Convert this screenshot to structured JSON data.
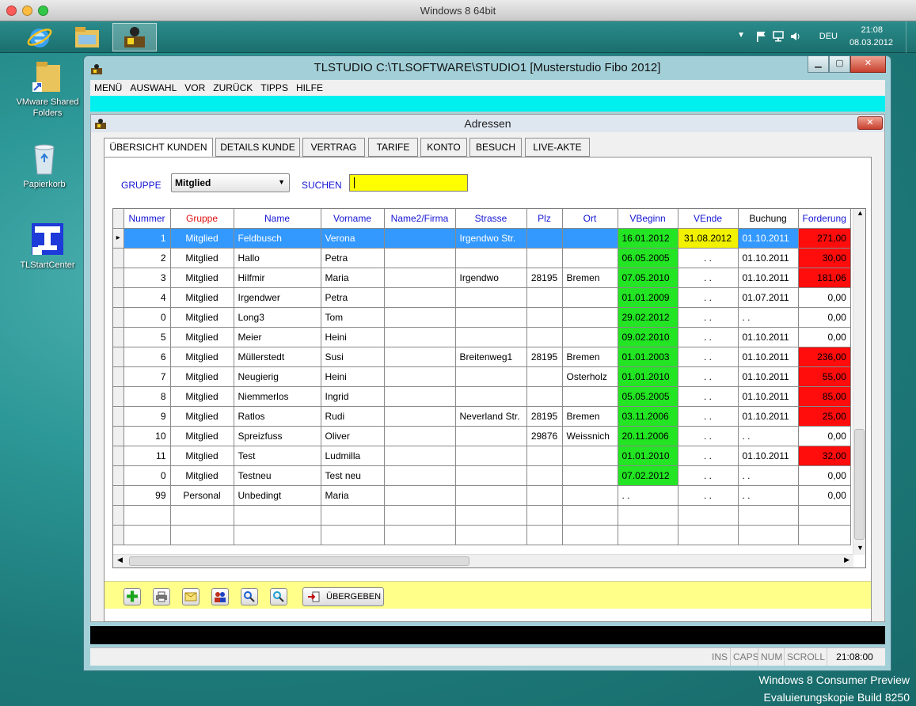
{
  "host": {
    "title": "Windows 8 64bit"
  },
  "taskbar": {
    "items": [
      "internet-explorer-icon",
      "file-explorer-icon",
      "tlstudio-app-icon"
    ]
  },
  "tray": {
    "language": "DEU",
    "time": "21:08",
    "date": "08.03.2012"
  },
  "desktop": {
    "icons": [
      {
        "label": "VMware Shared Folders"
      },
      {
        "label": "Papierkorb"
      },
      {
        "label": "TLStartCenter"
      }
    ]
  },
  "window": {
    "title": "TLSTUDIO C:\\TLSOFTWARE\\STUDIO1 [Musterstudio Fibo 2012]"
  },
  "menu": [
    "MENÜ",
    "AUSWAHL",
    "VOR",
    "ZURÜCK",
    "TIPPS",
    "HILFE"
  ],
  "child": {
    "title": "Adressen"
  },
  "tabs": [
    "ÜBERSICHT KUNDEN",
    "DETAILS KUNDE",
    "VERTRAG",
    "TARIFE",
    "KONTO",
    "BESUCH",
    "LIVE-AKTE"
  ],
  "filter": {
    "gruppe_label": "GRUPPE",
    "gruppe_value": "Mitglied",
    "suchen_label": "SUCHEN",
    "suchen_value": ""
  },
  "table": {
    "columns": [
      "Nummer",
      "Gruppe",
      "Name",
      "Vorname",
      "Name2/Firma",
      "Strasse",
      "Plz",
      "Ort",
      "VBeginn",
      "VEnde",
      "Buchung",
      "Forderung"
    ],
    "rows": [
      [
        "1",
        "Mitglied",
        "Feldbusch",
        "Verona",
        "",
        "Irgendwo Str.",
        "",
        "",
        "16.01.2012",
        "31.08.2012",
        "01.10.2011",
        "271,00"
      ],
      [
        "2",
        "Mitglied",
        "Hallo",
        "Petra",
        "",
        "",
        "",
        "",
        "06.05.2005",
        ". .",
        "01.10.2011",
        "30,00"
      ],
      [
        "3",
        "Mitglied",
        "Hilfmir",
        "Maria",
        "",
        "Irgendwo",
        "28195",
        "Bremen",
        "07.05.2010",
        ". .",
        "01.10.2011",
        "181,06"
      ],
      [
        "4",
        "Mitglied",
        "Irgendwer",
        "Petra",
        "",
        "",
        "",
        "",
        "01.01.2009",
        ". .",
        "01.07.2011",
        "0,00"
      ],
      [
        "0",
        "Mitglied",
        "Long3",
        "Tom",
        "",
        "",
        "",
        "",
        "29.02.2012",
        ". .",
        ". .",
        "0,00"
      ],
      [
        "5",
        "Mitglied",
        "Meier",
        "Heini",
        "",
        "",
        "",
        "",
        "09.02.2010",
        ". .",
        "01.10.2011",
        "0,00"
      ],
      [
        "6",
        "Mitglied",
        "Müllerstedt",
        "Susi",
        "",
        "Breitenweg1",
        "28195",
        "Bremen",
        "01.01.2003",
        ". .",
        "01.10.2011",
        "236,00"
      ],
      [
        "7",
        "Mitglied",
        "Neugierig",
        "Heini",
        "",
        "",
        "",
        "Osterholz",
        "01.01.2010",
        ". .",
        "01.10.2011",
        "55,00"
      ],
      [
        "8",
        "Mitglied",
        "Niemmerlos",
        "Ingrid",
        "",
        "",
        "",
        "",
        "05.05.2005",
        ". .",
        "01.10.2011",
        "85,00"
      ],
      [
        "9",
        "Mitglied",
        "Ratlos",
        "Rudi",
        "",
        "Neverland Str.",
        "28195",
        "Bremen",
        "03.11.2006",
        ". .",
        "01.10.2011",
        "25,00"
      ],
      [
        "10",
        "Mitglied",
        "Spreizfuss",
        "Oliver",
        "",
        "",
        "29876",
        "Weissnich",
        "20.11.2006",
        ". .",
        ". .",
        "0,00"
      ],
      [
        "11",
        "Mitglied",
        "Test",
        "Ludmilla",
        "",
        "",
        "",
        "",
        "01.01.2010",
        ". .",
        "01.10.2011",
        "32,00"
      ],
      [
        "0",
        "Mitglied",
        "Testneu",
        "Test neu",
        "",
        "",
        "",
        "",
        "07.02.2012",
        ". .",
        ". .",
        "0,00"
      ],
      [
        "99",
        "Personal",
        "Unbedingt",
        "Maria",
        "",
        "",
        "",
        "",
        ". .",
        ". .",
        ". .",
        "0,00"
      ]
    ]
  },
  "toolbar": {
    "uebergeben_label": "ÜBERGEBEN"
  },
  "status": {
    "ins": "INS",
    "caps": "CAPS",
    "num": "NUM",
    "scroll": "SCROLL",
    "time": "21:08:00"
  },
  "watermark": {
    "line1": "Windows 8 Consumer Preview",
    "line2": "Evaluierungskopie Build 8250"
  },
  "colors": {
    "desktop": "#1f7f7e",
    "selection": "#3399ff",
    "green": "#23e523",
    "yellow": "#f2f200",
    "red": "#ff0c0c",
    "cyan_bar": "#00f0f0",
    "toolbar_yellow": "#ffff8a"
  }
}
